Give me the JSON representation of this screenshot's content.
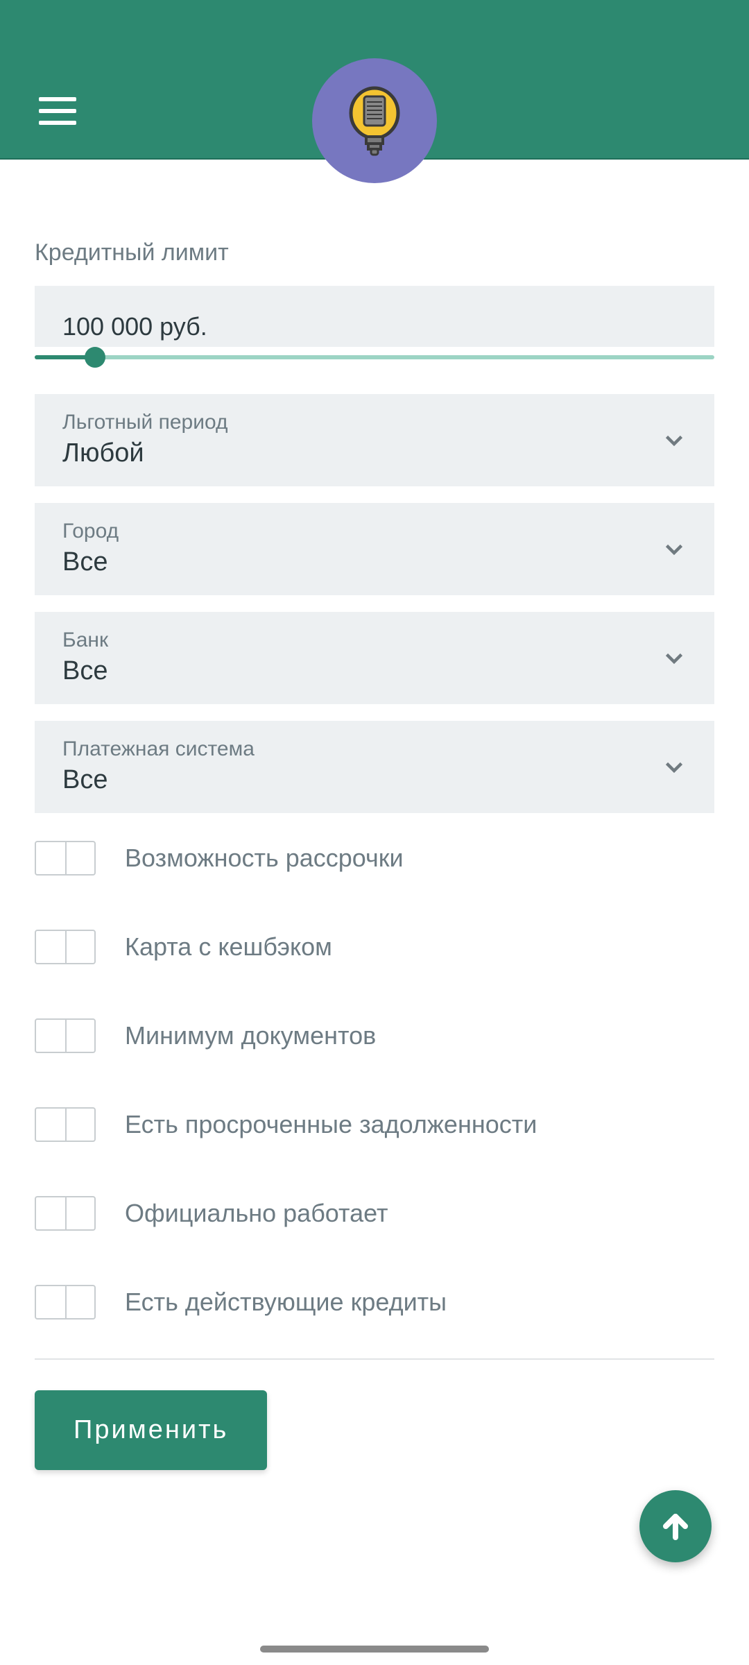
{
  "section_label": "Кредитный лимит",
  "credit_limit": {
    "display": "100 000 руб."
  },
  "dropdowns": {
    "grace": {
      "label": "Льготный период",
      "value": "Любой"
    },
    "city": {
      "label": "Город",
      "value": "Все"
    },
    "bank": {
      "label": "Банк",
      "value": "Все"
    },
    "paysys": {
      "label": "Платежная система",
      "value": "Все"
    }
  },
  "toggles": {
    "installment": "Возможность рассрочки",
    "cashback": "Карта с кешбэком",
    "mindocs": "Минимум документов",
    "overdue": "Есть просроченные задолженности",
    "employed": "Официально работает",
    "existing": "Есть действующие кредиты"
  },
  "apply_button": "Применить",
  "colors": {
    "brand": "#2d8970",
    "logo_bg": "#7777c0"
  }
}
